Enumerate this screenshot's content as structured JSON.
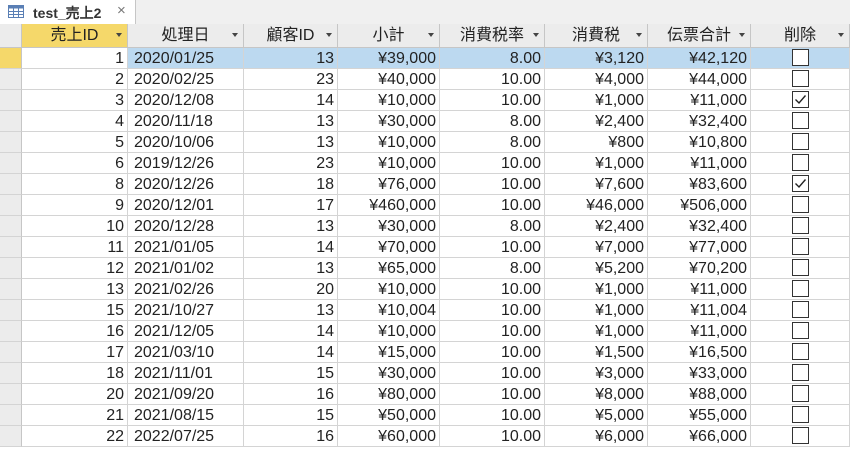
{
  "tab": {
    "title": "test_売上2",
    "close_label": "×",
    "icon": "table-icon"
  },
  "columns": [
    {
      "label": "売上ID",
      "sorted": true
    },
    {
      "label": "処理日"
    },
    {
      "label": "顧客ID"
    },
    {
      "label": "小計"
    },
    {
      "label": "消費税率"
    },
    {
      "label": "消費税"
    },
    {
      "label": "伝票合計"
    },
    {
      "label": "削除"
    }
  ],
  "colors": {
    "selected_row": "#bcd9f0",
    "sorted_header": "#f5d86a",
    "header_bg": "#ececec"
  },
  "rows": [
    {
      "id": "1",
      "date": "2020/01/25",
      "customer": "13",
      "subtotal": "¥39,000",
      "rate": "8.00",
      "tax": "¥3,120",
      "total": "¥42,120",
      "deleted": false,
      "selected": true
    },
    {
      "id": "2",
      "date": "2020/02/25",
      "customer": "23",
      "subtotal": "¥40,000",
      "rate": "10.00",
      "tax": "¥4,000",
      "total": "¥44,000",
      "deleted": false
    },
    {
      "id": "3",
      "date": "2020/12/08",
      "customer": "14",
      "subtotal": "¥10,000",
      "rate": "10.00",
      "tax": "¥1,000",
      "total": "¥11,000",
      "deleted": true
    },
    {
      "id": "4",
      "date": "2020/11/18",
      "customer": "13",
      "subtotal": "¥30,000",
      "rate": "8.00",
      "tax": "¥2,400",
      "total": "¥32,400",
      "deleted": false
    },
    {
      "id": "5",
      "date": "2020/10/06",
      "customer": "13",
      "subtotal": "¥10,000",
      "rate": "8.00",
      "tax": "¥800",
      "total": "¥10,800",
      "deleted": false
    },
    {
      "id": "6",
      "date": "2019/12/26",
      "customer": "23",
      "subtotal": "¥10,000",
      "rate": "10.00",
      "tax": "¥1,000",
      "total": "¥11,000",
      "deleted": false
    },
    {
      "id": "8",
      "date": "2020/12/26",
      "customer": "18",
      "subtotal": "¥76,000",
      "rate": "10.00",
      "tax": "¥7,600",
      "total": "¥83,600",
      "deleted": true
    },
    {
      "id": "9",
      "date": "2020/12/01",
      "customer": "17",
      "subtotal": "¥460,000",
      "rate": "10.00",
      "tax": "¥46,000",
      "total": "¥506,000",
      "deleted": false
    },
    {
      "id": "10",
      "date": "2020/12/28",
      "customer": "13",
      "subtotal": "¥30,000",
      "rate": "8.00",
      "tax": "¥2,400",
      "total": "¥32,400",
      "deleted": false
    },
    {
      "id": "11",
      "date": "2021/01/05",
      "customer": "14",
      "subtotal": "¥70,000",
      "rate": "10.00",
      "tax": "¥7,000",
      "total": "¥77,000",
      "deleted": false
    },
    {
      "id": "12",
      "date": "2021/01/02",
      "customer": "13",
      "subtotal": "¥65,000",
      "rate": "8.00",
      "tax": "¥5,200",
      "total": "¥70,200",
      "deleted": false
    },
    {
      "id": "13",
      "date": "2021/02/26",
      "customer": "20",
      "subtotal": "¥10,000",
      "rate": "10.00",
      "tax": "¥1,000",
      "total": "¥11,000",
      "deleted": false
    },
    {
      "id": "15",
      "date": "2021/10/27",
      "customer": "13",
      "subtotal": "¥10,004",
      "rate": "10.00",
      "tax": "¥1,000",
      "total": "¥11,004",
      "deleted": false
    },
    {
      "id": "16",
      "date": "2021/12/05",
      "customer": "14",
      "subtotal": "¥10,000",
      "rate": "10.00",
      "tax": "¥1,000",
      "total": "¥11,000",
      "deleted": false
    },
    {
      "id": "17",
      "date": "2021/03/10",
      "customer": "14",
      "subtotal": "¥15,000",
      "rate": "10.00",
      "tax": "¥1,500",
      "total": "¥16,500",
      "deleted": false
    },
    {
      "id": "18",
      "date": "2021/11/01",
      "customer": "15",
      "subtotal": "¥30,000",
      "rate": "10.00",
      "tax": "¥3,000",
      "total": "¥33,000",
      "deleted": false
    },
    {
      "id": "20",
      "date": "2021/09/20",
      "customer": "16",
      "subtotal": "¥80,000",
      "rate": "10.00",
      "tax": "¥8,000",
      "total": "¥88,000",
      "deleted": false
    },
    {
      "id": "21",
      "date": "2021/08/15",
      "customer": "15",
      "subtotal": "¥50,000",
      "rate": "10.00",
      "tax": "¥5,000",
      "total": "¥55,000",
      "deleted": false
    },
    {
      "id": "22",
      "date": "2022/07/25",
      "customer": "16",
      "subtotal": "¥60,000",
      "rate": "10.00",
      "tax": "¥6,000",
      "total": "¥66,000",
      "deleted": false
    }
  ]
}
